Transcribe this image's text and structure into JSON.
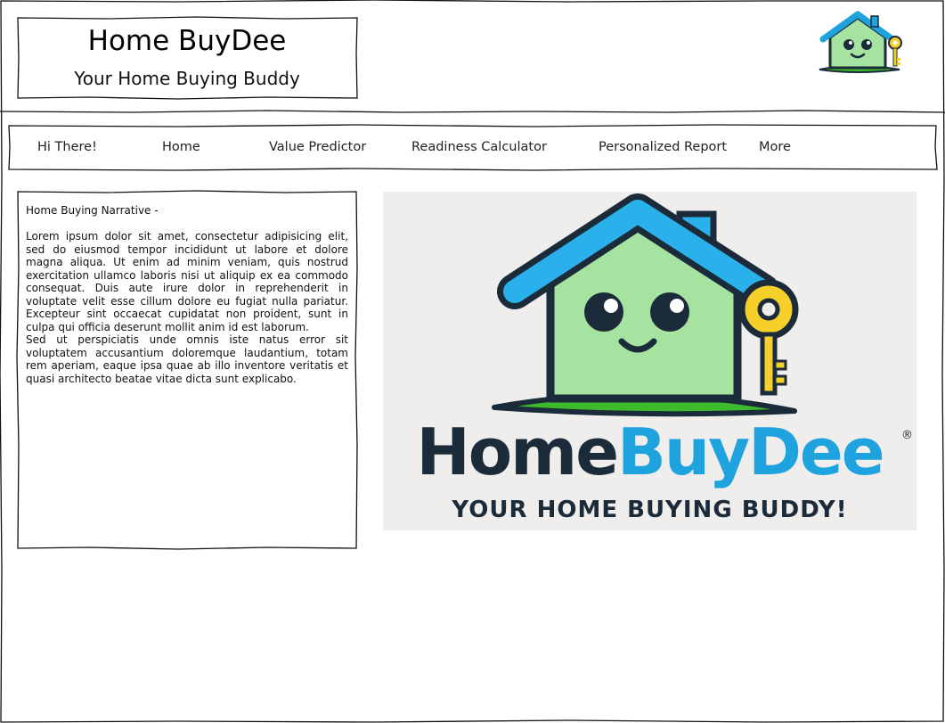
{
  "header": {
    "title": "Home BuyDee",
    "subtitle": "Your Home Buying Buddy",
    "logo_icon": "house-key-mascot-icon"
  },
  "nav": {
    "items": [
      {
        "label": "Hi There!"
      },
      {
        "label": "Home"
      },
      {
        "label": "Value Predictor"
      },
      {
        "label": "Readiness Calculator"
      },
      {
        "label": "Personalized Report"
      },
      {
        "label": "More"
      }
    ]
  },
  "narrative": {
    "heading": "Home Buying Narrative -",
    "body": "Lorem ipsum dolor sit amet, consectetur adipisicing elit, sed do eiusmod tempor incididunt ut labore et dolore magna aliqua. Ut enim ad minim veniam, quis nostrud exercitation ullamco laboris nisi ut aliquip ex ea commodo consequat. Duis aute irure dolor in reprehenderit in voluptate velit esse cillum dolore eu fugiat nulla pariatur. Excepteur sint occaecat cupidatat non proident, sunt in culpa qui officia deserunt mollit anim id est laborum.\nSed ut perspiciatis unde omnis iste natus error sit voluptatem accusantium doloremque laudantium, totam rem aperiam, eaque ipsa quae ab illo inventore veritatis et quasi architecto beatae vitae dicta sunt explicabo."
  },
  "hero": {
    "brand_part1": "Home",
    "brand_part2": "BuyDee",
    "registered_mark": "®",
    "tagline": "YOUR HOME BUYING BUDDY!"
  },
  "colors": {
    "brand_blue": "#1ea3de",
    "brand_dark": "#1b2b3a",
    "house_green": "#a6e3a1",
    "grass_green": "#3dbb2c",
    "key_yellow": "#f5cf2a"
  }
}
